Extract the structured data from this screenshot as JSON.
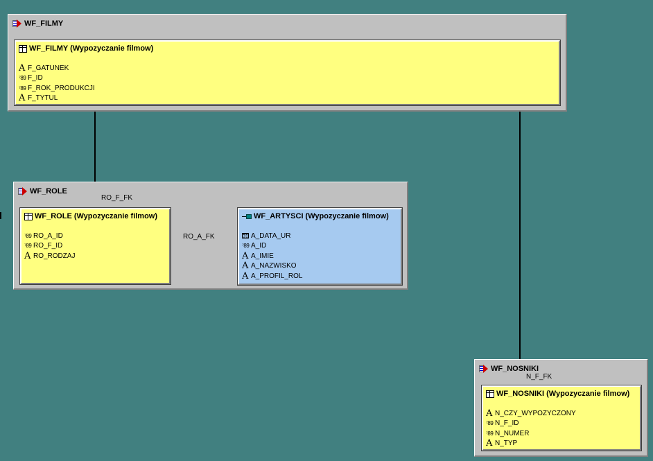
{
  "folders": {
    "filmy": {
      "title": "WF_FILMY"
    },
    "role": {
      "title": "WF_ROLE"
    },
    "nosniki": {
      "title": "WF_NOSNIKI"
    }
  },
  "tables": {
    "filmy": {
      "title": "WF_FILMY (Wypozyczanie filmow)",
      "columns": [
        {
          "name": "F_GATUNEK",
          "type_icon": "A"
        },
        {
          "name": "F_ID",
          "type_icon": "789"
        },
        {
          "name": "F_ROK_PRODUKCJI",
          "type_icon": "789"
        },
        {
          "name": "F_TYTUL",
          "type_icon": "A"
        }
      ]
    },
    "role": {
      "title": "WF_ROLE (Wypozyczanie filmow)",
      "columns": [
        {
          "name": "RO_A_ID",
          "type_icon": "789"
        },
        {
          "name": "RO_F_ID",
          "type_icon": "789"
        },
        {
          "name": "RO_RODZAJ",
          "type_icon": "A"
        }
      ]
    },
    "artysci": {
      "title": "WF_ARTYSCI (Wypozyczanie filmow)",
      "columns": [
        {
          "name": "A_DATA_UR",
          "type_icon": "31"
        },
        {
          "name": "A_ID",
          "type_icon": "789"
        },
        {
          "name": "A_IMIE",
          "type_icon": "A"
        },
        {
          "name": "A_NAZWISKO",
          "type_icon": "A"
        },
        {
          "name": "A_PROFIL_ROL",
          "type_icon": "A"
        }
      ]
    },
    "nosniki": {
      "title": "WF_NOSNIKI (Wypozyczanie filmow)",
      "columns": [
        {
          "name": "N_CZY_WYPOZYCZONY",
          "type_icon": "A"
        },
        {
          "name": "N_F_ID",
          "type_icon": "789"
        },
        {
          "name": "N_NUMER",
          "type_icon": "789"
        },
        {
          "name": "N_TYP",
          "type_icon": "A"
        }
      ]
    }
  },
  "relations": {
    "ro_f_fk": "RO_F_FK",
    "ro_a_fk": "RO_A_FK",
    "n_f_fk": "N_F_FK"
  },
  "icons": {
    "folder": "model-folder-icon",
    "table": "table-icon",
    "view": "view-icon",
    "text_type": "text-type-icon",
    "number_type": "number-type-icon",
    "date_type": "date-type-icon"
  },
  "colors": {
    "background": "#418080",
    "table_fill": "#ffff80",
    "view_fill": "#a6caf0",
    "folder_fill": "#c0c0c0"
  }
}
